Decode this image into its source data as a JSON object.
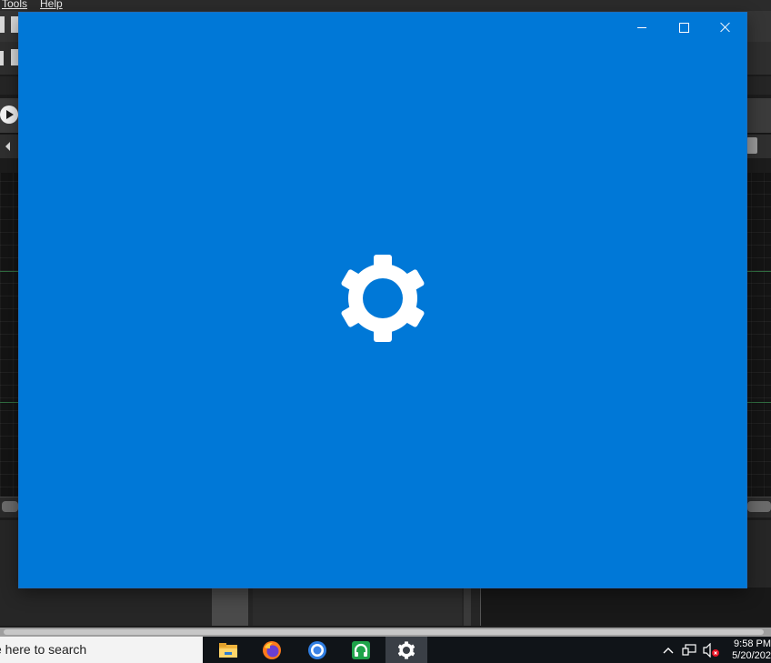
{
  "background_app": {
    "menu": {
      "tools": "Tools",
      "help": "Help"
    }
  },
  "settings_window": {
    "background_color": "#0078d7",
    "center_icon": "gear-icon",
    "controls": {
      "minimize": "minimize-icon",
      "maximize": "maximize-icon",
      "close": "close-icon"
    }
  },
  "taskbar": {
    "search_placeholder": "Type here to search",
    "search_visible_text": "e here to search",
    "apps": [
      {
        "name": "File Explorer",
        "icon": "folder-icon"
      },
      {
        "name": "Firefox",
        "icon": "firefox-icon"
      },
      {
        "name": "Chrome",
        "icon": "chrome-icon"
      },
      {
        "name": "Green app",
        "icon": "headphones-icon"
      },
      {
        "name": "Settings",
        "icon": "gear-icon",
        "active": true
      }
    ],
    "tray_icons": [
      "chevron-up-icon",
      "network-icon",
      "volume-muted-icon"
    ],
    "time": "9:58 PM",
    "date": "5/20/202"
  }
}
